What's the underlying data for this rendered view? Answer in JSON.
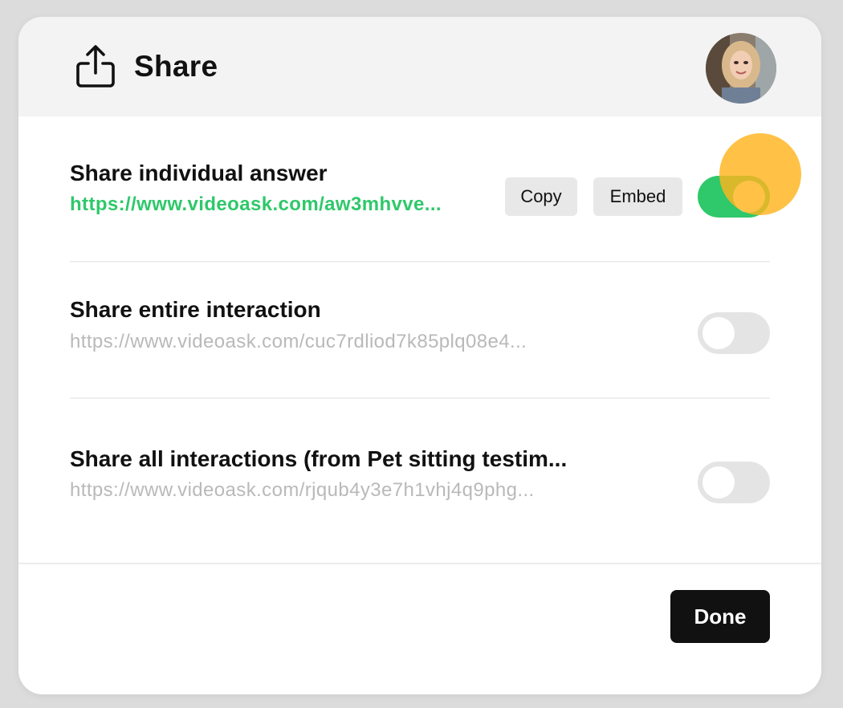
{
  "modal": {
    "title": "Share",
    "icons": {
      "share": "share-upload-icon",
      "avatar": "user-avatar"
    }
  },
  "rows": [
    {
      "title": "Share individual answer",
      "url": "https://www.videoask.com/aw3mhvve...",
      "enabled": true,
      "copy_label": "Copy",
      "embed_label": "Embed"
    },
    {
      "title": "Share entire interaction",
      "url": "https://www.videoask.com/cuc7rdliod7k85plq08e4...",
      "enabled": false
    },
    {
      "title": "Share all interactions (from Pet sitting testim...",
      "url": "https://www.videoask.com/rjqub4y3e7h1vhj4q9phg...",
      "enabled": false
    }
  ],
  "footer": {
    "done_label": "Done"
  },
  "colors": {
    "accent_green": "#2fc86a",
    "header_bg": "#f3f3f3",
    "primary_button": "#111111",
    "click_indicator": "#ffb41e"
  }
}
